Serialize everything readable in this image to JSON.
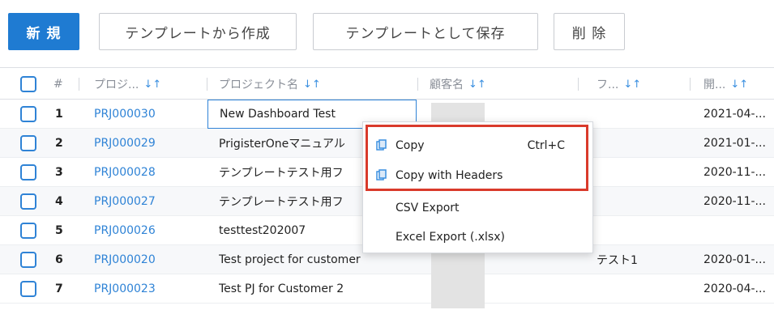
{
  "toolbar": {
    "new_label": "新 規",
    "from_template_label": "テンプレートから作成",
    "save_template_label": "テンプレートとして保存",
    "delete_label": "削 除"
  },
  "table": {
    "sort_glyph": "↓↑",
    "headers": {
      "num": "#",
      "code": "プロジ...",
      "name": "プロジェクト名",
      "customer": "顧客名",
      "phase": "フ...",
      "start": "開..."
    },
    "rows": [
      {
        "num": "1",
        "code": "PRJ000030",
        "name": "New Dashboard Test",
        "phase": "",
        "start": "2021-04-..."
      },
      {
        "num": "2",
        "code": "PRJ000029",
        "name": "PrigisterOneマニュアル",
        "phase": "",
        "start": "2021-01-..."
      },
      {
        "num": "3",
        "code": "PRJ000028",
        "name": "テンプレートテスト用フ",
        "phase": "",
        "start": "2020-11-..."
      },
      {
        "num": "4",
        "code": "PRJ000027",
        "name": "テンプレートテスト用フ",
        "phase": "",
        "start": "2020-11-..."
      },
      {
        "num": "5",
        "code": "PRJ000026",
        "name": "testtest202007",
        "phase": "",
        "start": ""
      },
      {
        "num": "6",
        "code": "PRJ000020",
        "name": "Test project for customer",
        "phase": "テスト1",
        "start": "2020-01-..."
      },
      {
        "num": "7",
        "code": "PRJ000023",
        "name": "Test PJ for Customer 2",
        "phase": "",
        "start": "2020-04-..."
      }
    ]
  },
  "context_menu": {
    "copy_label": "Copy",
    "copy_shortcut": "Ctrl+C",
    "copy_headers_label": "Copy with Headers",
    "csv_label": "CSV Export",
    "excel_label": "Excel Export (.xlsx)"
  },
  "colors": {
    "primary": "#1f7bd2",
    "link": "#2f83d6",
    "highlight": "#d93a2b"
  }
}
